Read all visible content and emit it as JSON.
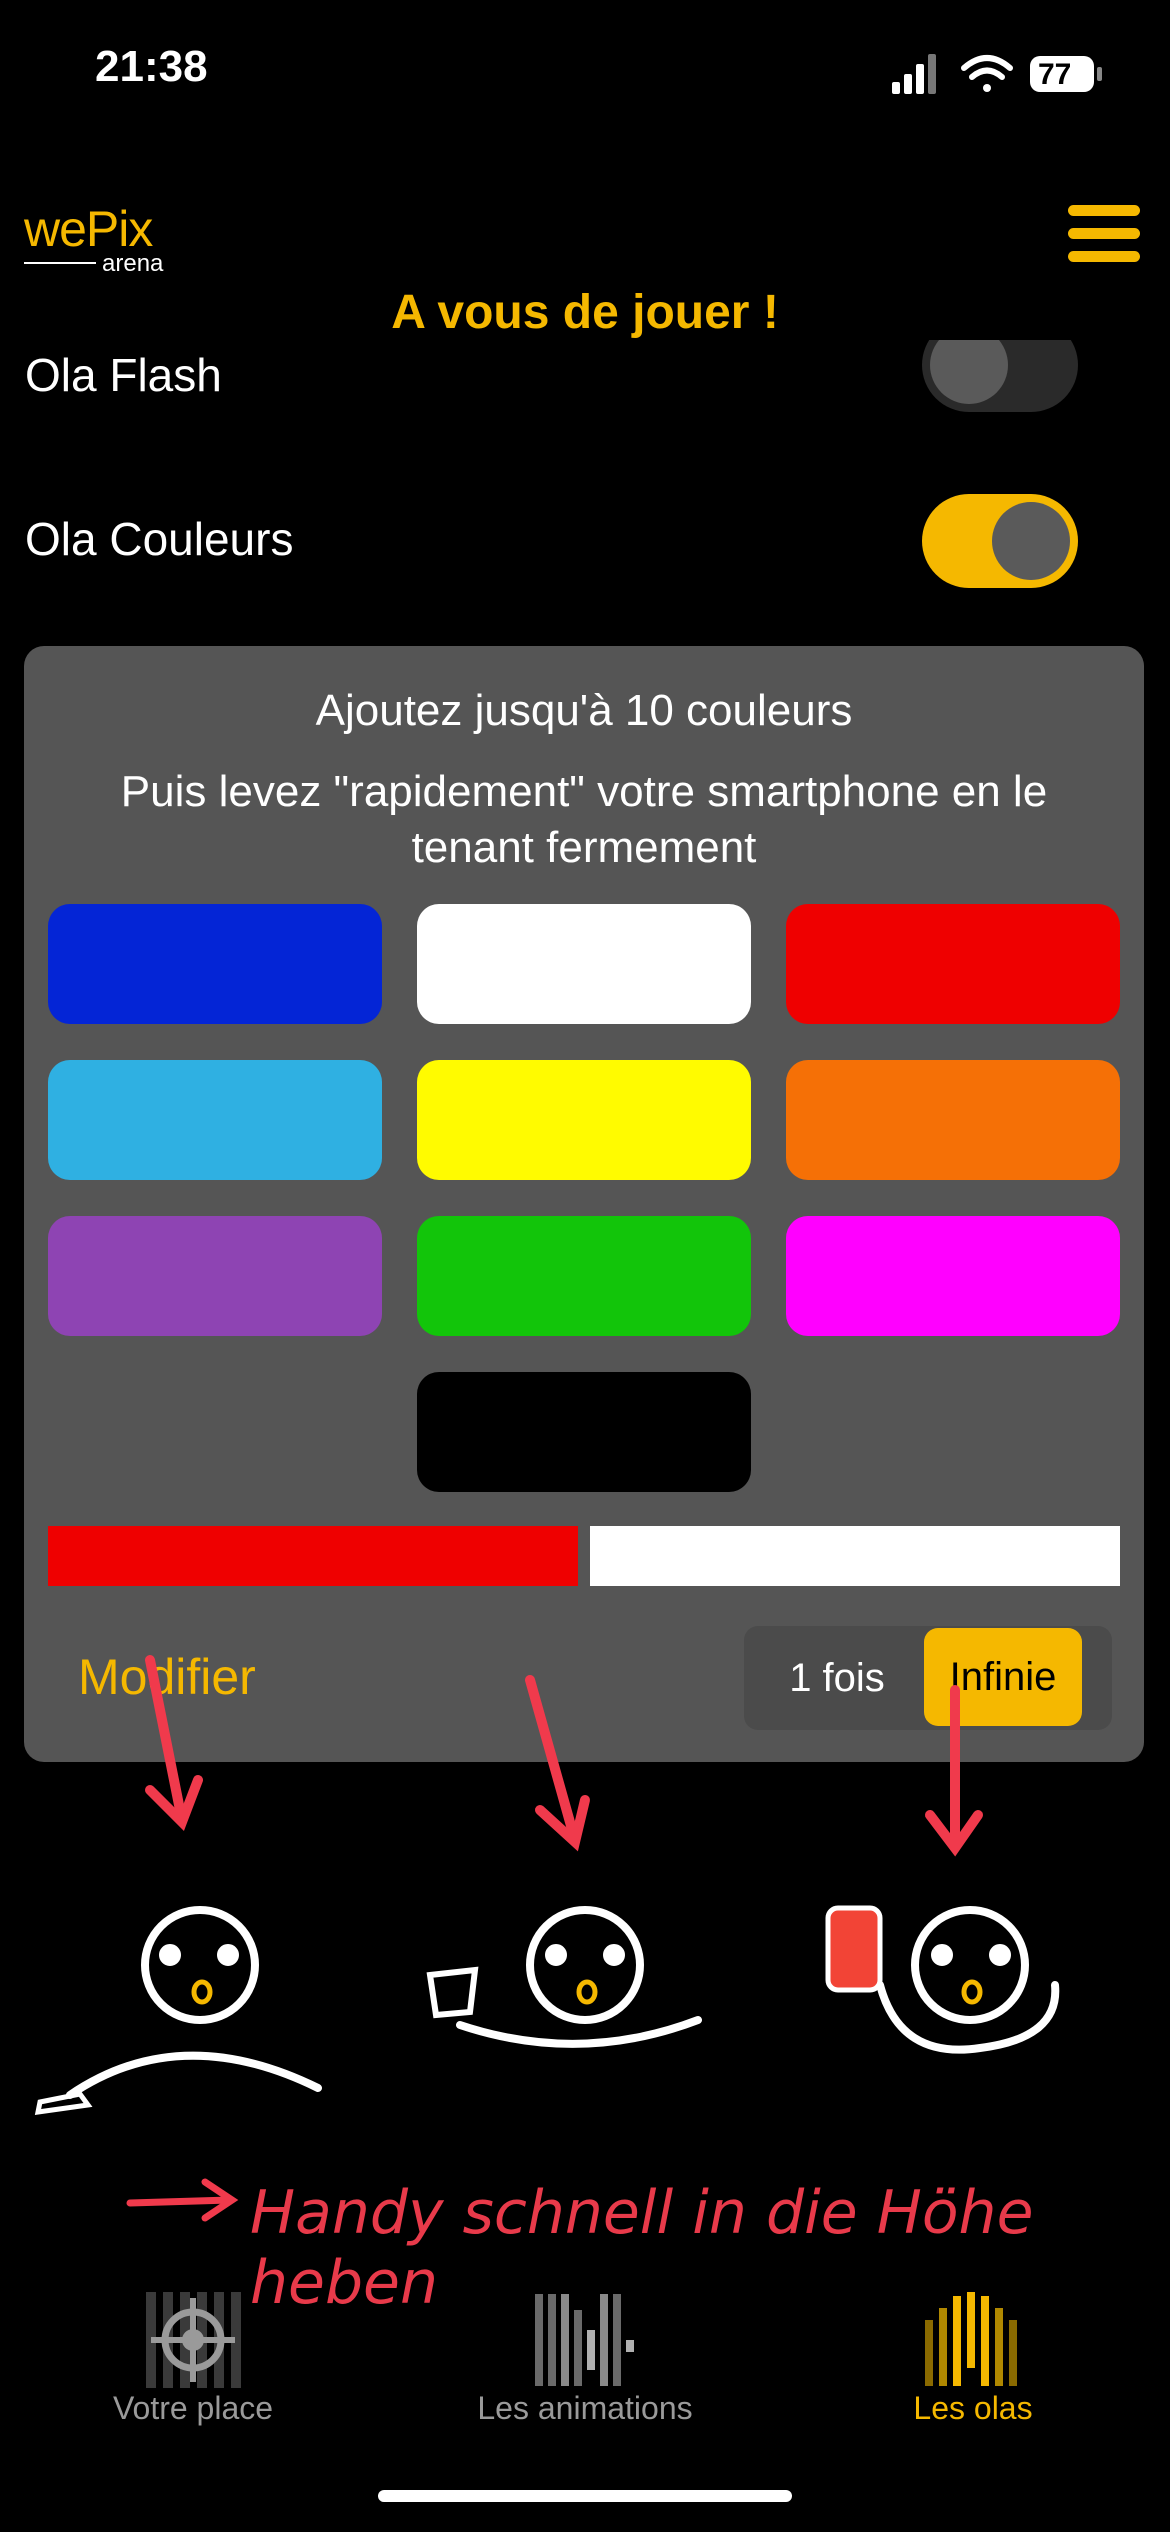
{
  "status_bar": {
    "time": "21:38",
    "battery": "77"
  },
  "header": {
    "logo_main": "wePix",
    "logo_sub": "arena",
    "title": "A vous de jouer !"
  },
  "toggles": [
    {
      "label": "Ola Flash",
      "on": false
    },
    {
      "label": "Ola Couleurs",
      "on": true
    }
  ],
  "card": {
    "title": "Ajoutez jusqu'à 10 couleurs",
    "subtitle": "Puis levez \"rapidement\" votre smartphone en le tenant fermement",
    "colors": [
      "#0425d6",
      "#ffffff",
      "#ef0000",
      "#2fb0e2",
      "#fffb00",
      "#f57006",
      "#8e44b3",
      "#12c50a",
      "#ff00ff",
      "#000000"
    ],
    "selected_colors": [
      "#ef0000",
      "#ffffff"
    ],
    "modify_label": "Modifier",
    "repeat_options": [
      "1 fois",
      "Infinie"
    ],
    "repeat_selected": "Infinie"
  },
  "annotation": {
    "text": "Handy schnell in die Höhe heben",
    "color": "#e83a4a"
  },
  "tabbar": {
    "items": [
      {
        "label": "Votre place",
        "icon": "crosshair-icon",
        "active": false
      },
      {
        "label": "Les animations",
        "icon": "light-bars-icon",
        "active": false
      },
      {
        "label": "Les olas",
        "icon": "wave-bars-icon",
        "active": true
      }
    ]
  },
  "accent_color": "#f5b800"
}
